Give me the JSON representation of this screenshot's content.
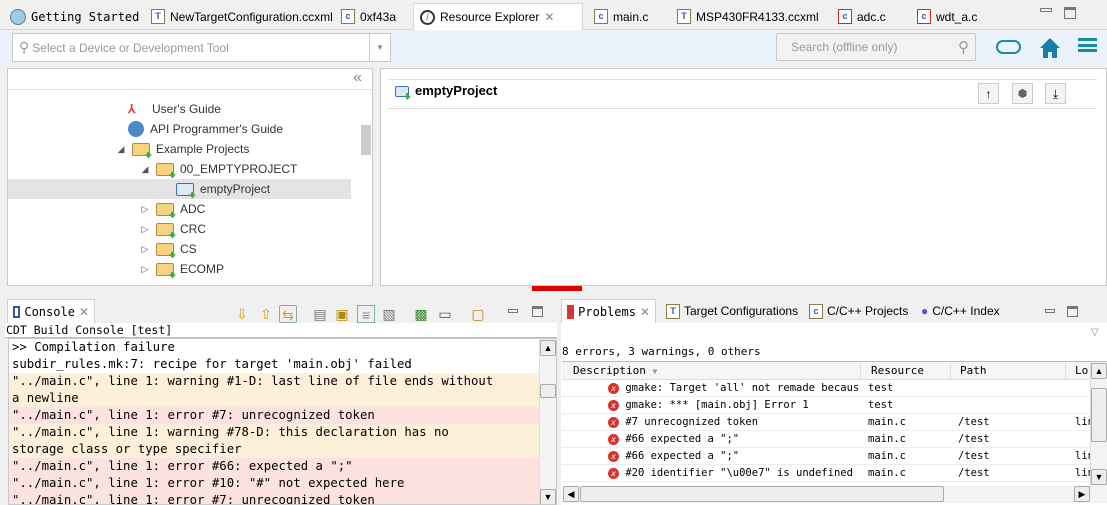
{
  "editor_tabs": [
    {
      "label": "Getting Started",
      "icon": "getting-started-icon"
    },
    {
      "label": "NewTargetConfiguration.ccxml",
      "icon": "target-config-icon"
    },
    {
      "label": "0xf43a",
      "icon": "c-file-icon"
    },
    {
      "label": "Resource Explorer",
      "icon": "compass-icon",
      "active": true
    },
    {
      "label": "main.c",
      "icon": "c-file-icon"
    },
    {
      "label": "MSP430FR4133.ccxml",
      "icon": "target-config-icon"
    },
    {
      "label": "adc.c",
      "icon": "c-file-error-icon"
    },
    {
      "label": "wdt_a.c",
      "icon": "c-file-error-icon"
    }
  ],
  "toolbar": {
    "device_placeholder": "Select a Device or Development Tool",
    "search_placeholder": "Search (offline only)"
  },
  "tree": {
    "items": [
      {
        "label": "User's Guide"
      },
      {
        "label": "API Programmer's Guide"
      },
      {
        "label": "Example Projects"
      },
      {
        "label": "00_EMPTYPROJECT"
      },
      {
        "label": "emptyProject"
      },
      {
        "label": "ADC"
      },
      {
        "label": "CRC"
      },
      {
        "label": "CS"
      },
      {
        "label": "ECOMP"
      }
    ]
  },
  "detail": {
    "title": "emptyProject"
  },
  "console": {
    "tab": "Console",
    "subtitle": "CDT Build Console [test]",
    "lines": [
      ">> Compilation failure",
      "subdir_rules.mk:7: recipe for target 'main.obj' failed",
      "\"../main.c\", line 1: warning #1-D: last line of file ends without",
      "a newline",
      "\"../main.c\", line 1: error #7: unrecognized token",
      "\"../main.c\", line 1: warning #78-D: this declaration has no",
      "storage class or type specifier",
      "\"../main.c\", line 1: error #66: expected a \";\"",
      "\"../main.c\", line 1: error #10: \"#\" not expected here",
      "\"../main.c\", line 1: error #7: unrecognized token"
    ]
  },
  "problems": {
    "tabs": [
      "Problems",
      "Target Configurations",
      "C/C++ Projects",
      "C/C++ Index"
    ],
    "summary": "8 errors, 3 warnings, 0 others",
    "columns": [
      "Description",
      "Resource",
      "Path",
      "Lo"
    ],
    "rows": [
      {
        "desc": "gmake: Target 'all' not remade because of errors.",
        "res": "test",
        "path": "",
        "loc": ""
      },
      {
        "desc": "gmake: *** [main.obj] Error 1",
        "res": "test",
        "path": "",
        "loc": ""
      },
      {
        "desc": "#7 unrecognized token",
        "res": "main.c",
        "path": "/test",
        "loc": "lin"
      },
      {
        "desc": "#66 expected a \";\"",
        "res": "main.c",
        "path": "/test",
        "loc": ""
      },
      {
        "desc": "#66 expected a \";\"",
        "res": "main.c",
        "path": "/test",
        "loc": "lin"
      },
      {
        "desc": "#20 identifier \"\\u00e7\" is undefined",
        "res": "main.c",
        "path": "/test",
        "loc": "lin"
      }
    ]
  }
}
